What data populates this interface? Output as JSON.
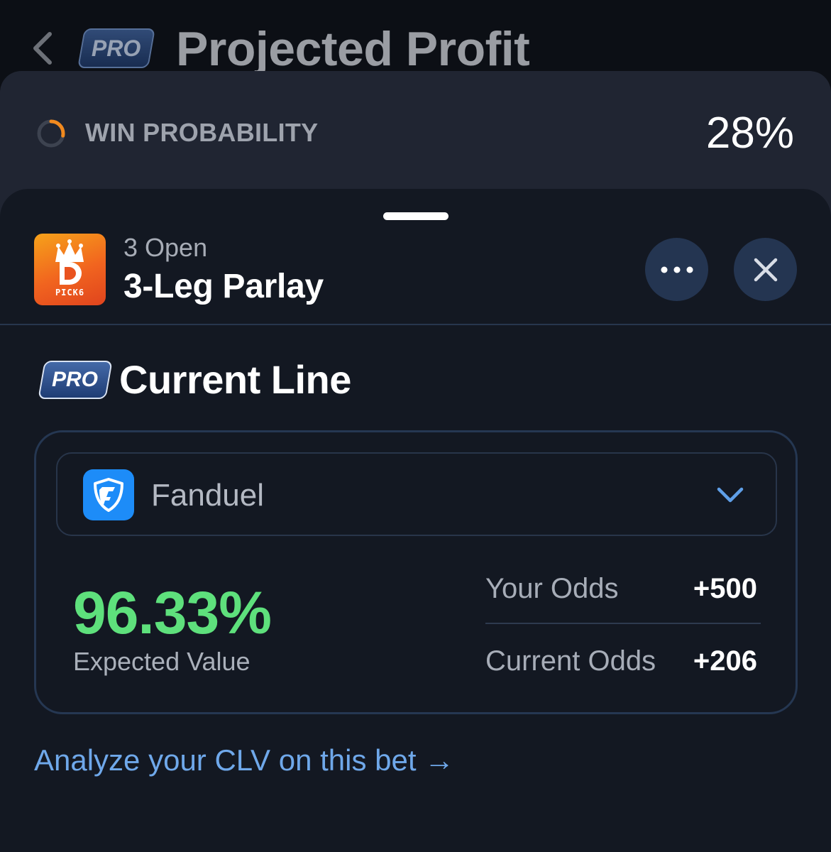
{
  "header": {
    "back_icon": "chevron-left-icon",
    "badge": "PRO",
    "title": "Projected Profit"
  },
  "win_probability": {
    "icon": "progress-ring-icon",
    "label": "WIN PROBABILITY",
    "value": "28%",
    "fraction": 0.28
  },
  "sheet": {
    "sportsbook_logo": {
      "name": "DraftKings Pick6",
      "text": "PICK6"
    },
    "subtitle": "3 Open",
    "title": "3-Leg Parlay",
    "more_icon": "ellipsis-icon",
    "close_icon": "close-icon",
    "section": {
      "badge": "PRO",
      "title": "Current Line"
    },
    "book_select": {
      "icon": "fanduel-shield-icon",
      "selected": "Fanduel",
      "dropdown_icon": "chevron-down-icon"
    },
    "expected_value": {
      "value": "96.33%",
      "label": "Expected Value"
    },
    "odds": {
      "your_label": "Your Odds",
      "your_value": "+500",
      "current_label": "Current Odds",
      "current_value": "+206"
    },
    "clv_link": "Analyze your CLV on this bet →"
  },
  "colors": {
    "positive": "#5ee07c",
    "link": "#6fa8ea",
    "accent_orange": "#f28a1e",
    "fanduel_blue": "#1d8cf8"
  }
}
